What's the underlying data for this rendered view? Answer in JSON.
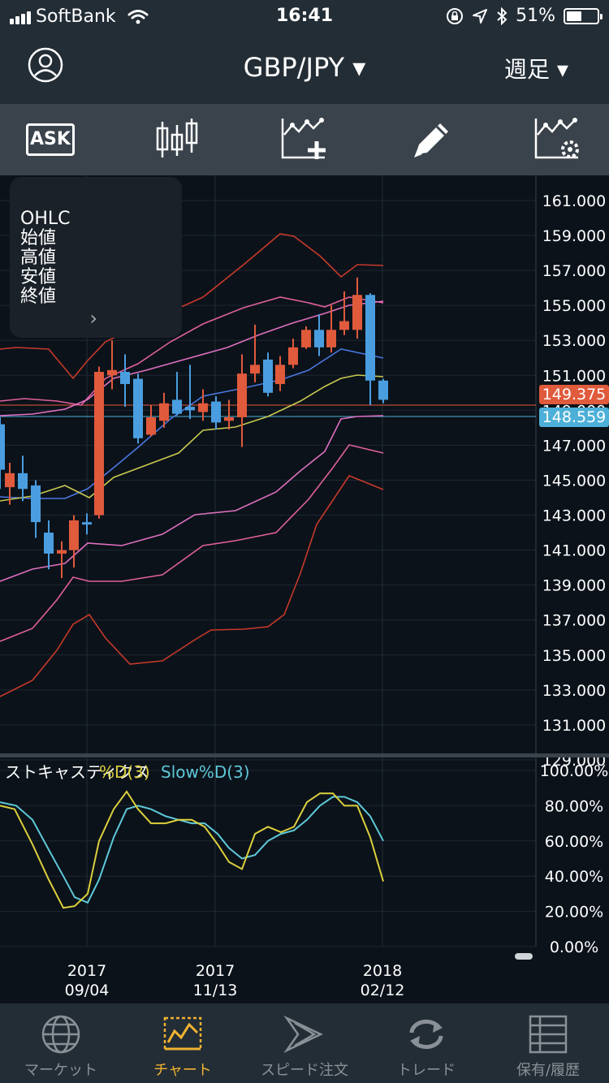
{
  "status": {
    "carrier": "SoftBank",
    "time": "16:41",
    "battery": "51%"
  },
  "header": {
    "pair": "GBP/JPY ▾",
    "period": "週足 ▾"
  },
  "toolbar": {
    "ask_label": "ASK"
  },
  "ohlc": {
    "lines": [
      "OHLC",
      "始値",
      "高値",
      "安値",
      "終値"
    ]
  },
  "price_axis": [
    "161.000",
    "159.000",
    "157.000",
    "155.000",
    "153.000",
    "151.000",
    "149.000",
    "147.000",
    "145.000",
    "143.000",
    "141.000",
    "139.000",
    "137.000",
    "135.000",
    "133.000",
    "131.000",
    "129.000"
  ],
  "price_tags": {
    "ask": "149.375",
    "bid": "148.559",
    "ask_color": "#e05a3c",
    "bid_color": "#4db0d8"
  },
  "stoch": {
    "label_main": "ストキャスティクス",
    "label_d": "%D(3)",
    "label_slow": "Slow%D(3)",
    "axis": [
      "100.00%",
      "80.00%",
      "60.00%",
      "40.00%",
      "20.00%",
      "0.00%"
    ],
    "d_color": "#dccf3c",
    "slow_color": "#5ec8d8"
  },
  "dates": [
    {
      "year": "2017",
      "md": "09/04"
    },
    {
      "year": "2017",
      "md": "11/13"
    },
    {
      "year": "2018",
      "md": "02/12"
    }
  ],
  "tabs": [
    "マーケット",
    "チャート",
    "スピード注文",
    "トレード",
    "保有/履歴"
  ],
  "colors": {
    "up": "#e05a3c",
    "down": "#4a9ee0",
    "accent": "#f0b230"
  }
}
